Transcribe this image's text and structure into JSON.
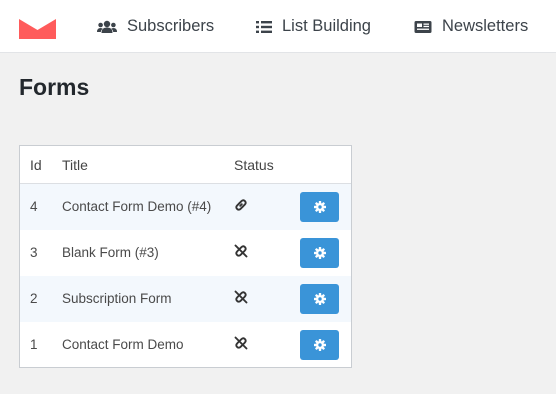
{
  "nav": {
    "logo": "mail-logo-icon",
    "items": [
      {
        "label": "Subscribers",
        "icon": "users-icon"
      },
      {
        "label": "List Building",
        "icon": "list-icon"
      },
      {
        "label": "Newsletters",
        "icon": "newspaper-icon"
      }
    ]
  },
  "page": {
    "title": "Forms"
  },
  "table": {
    "columns": [
      "Id",
      "Title",
      "Status"
    ],
    "rows": [
      {
        "id": "4",
        "title": "Contact Form Demo (#4)",
        "status_icon": "link-icon"
      },
      {
        "id": "3",
        "title": "Blank Form (#3)",
        "status_icon": "unlink-icon"
      },
      {
        "id": "2",
        "title": "Subscription Form",
        "status_icon": "unlink-icon"
      },
      {
        "id": "1",
        "title": "Contact Form Demo",
        "status_icon": "unlink-icon"
      }
    ]
  },
  "colors": {
    "brand": "#ff5b5b",
    "button": "#3a94d8",
    "row_alt": "#f3f8fd"
  }
}
